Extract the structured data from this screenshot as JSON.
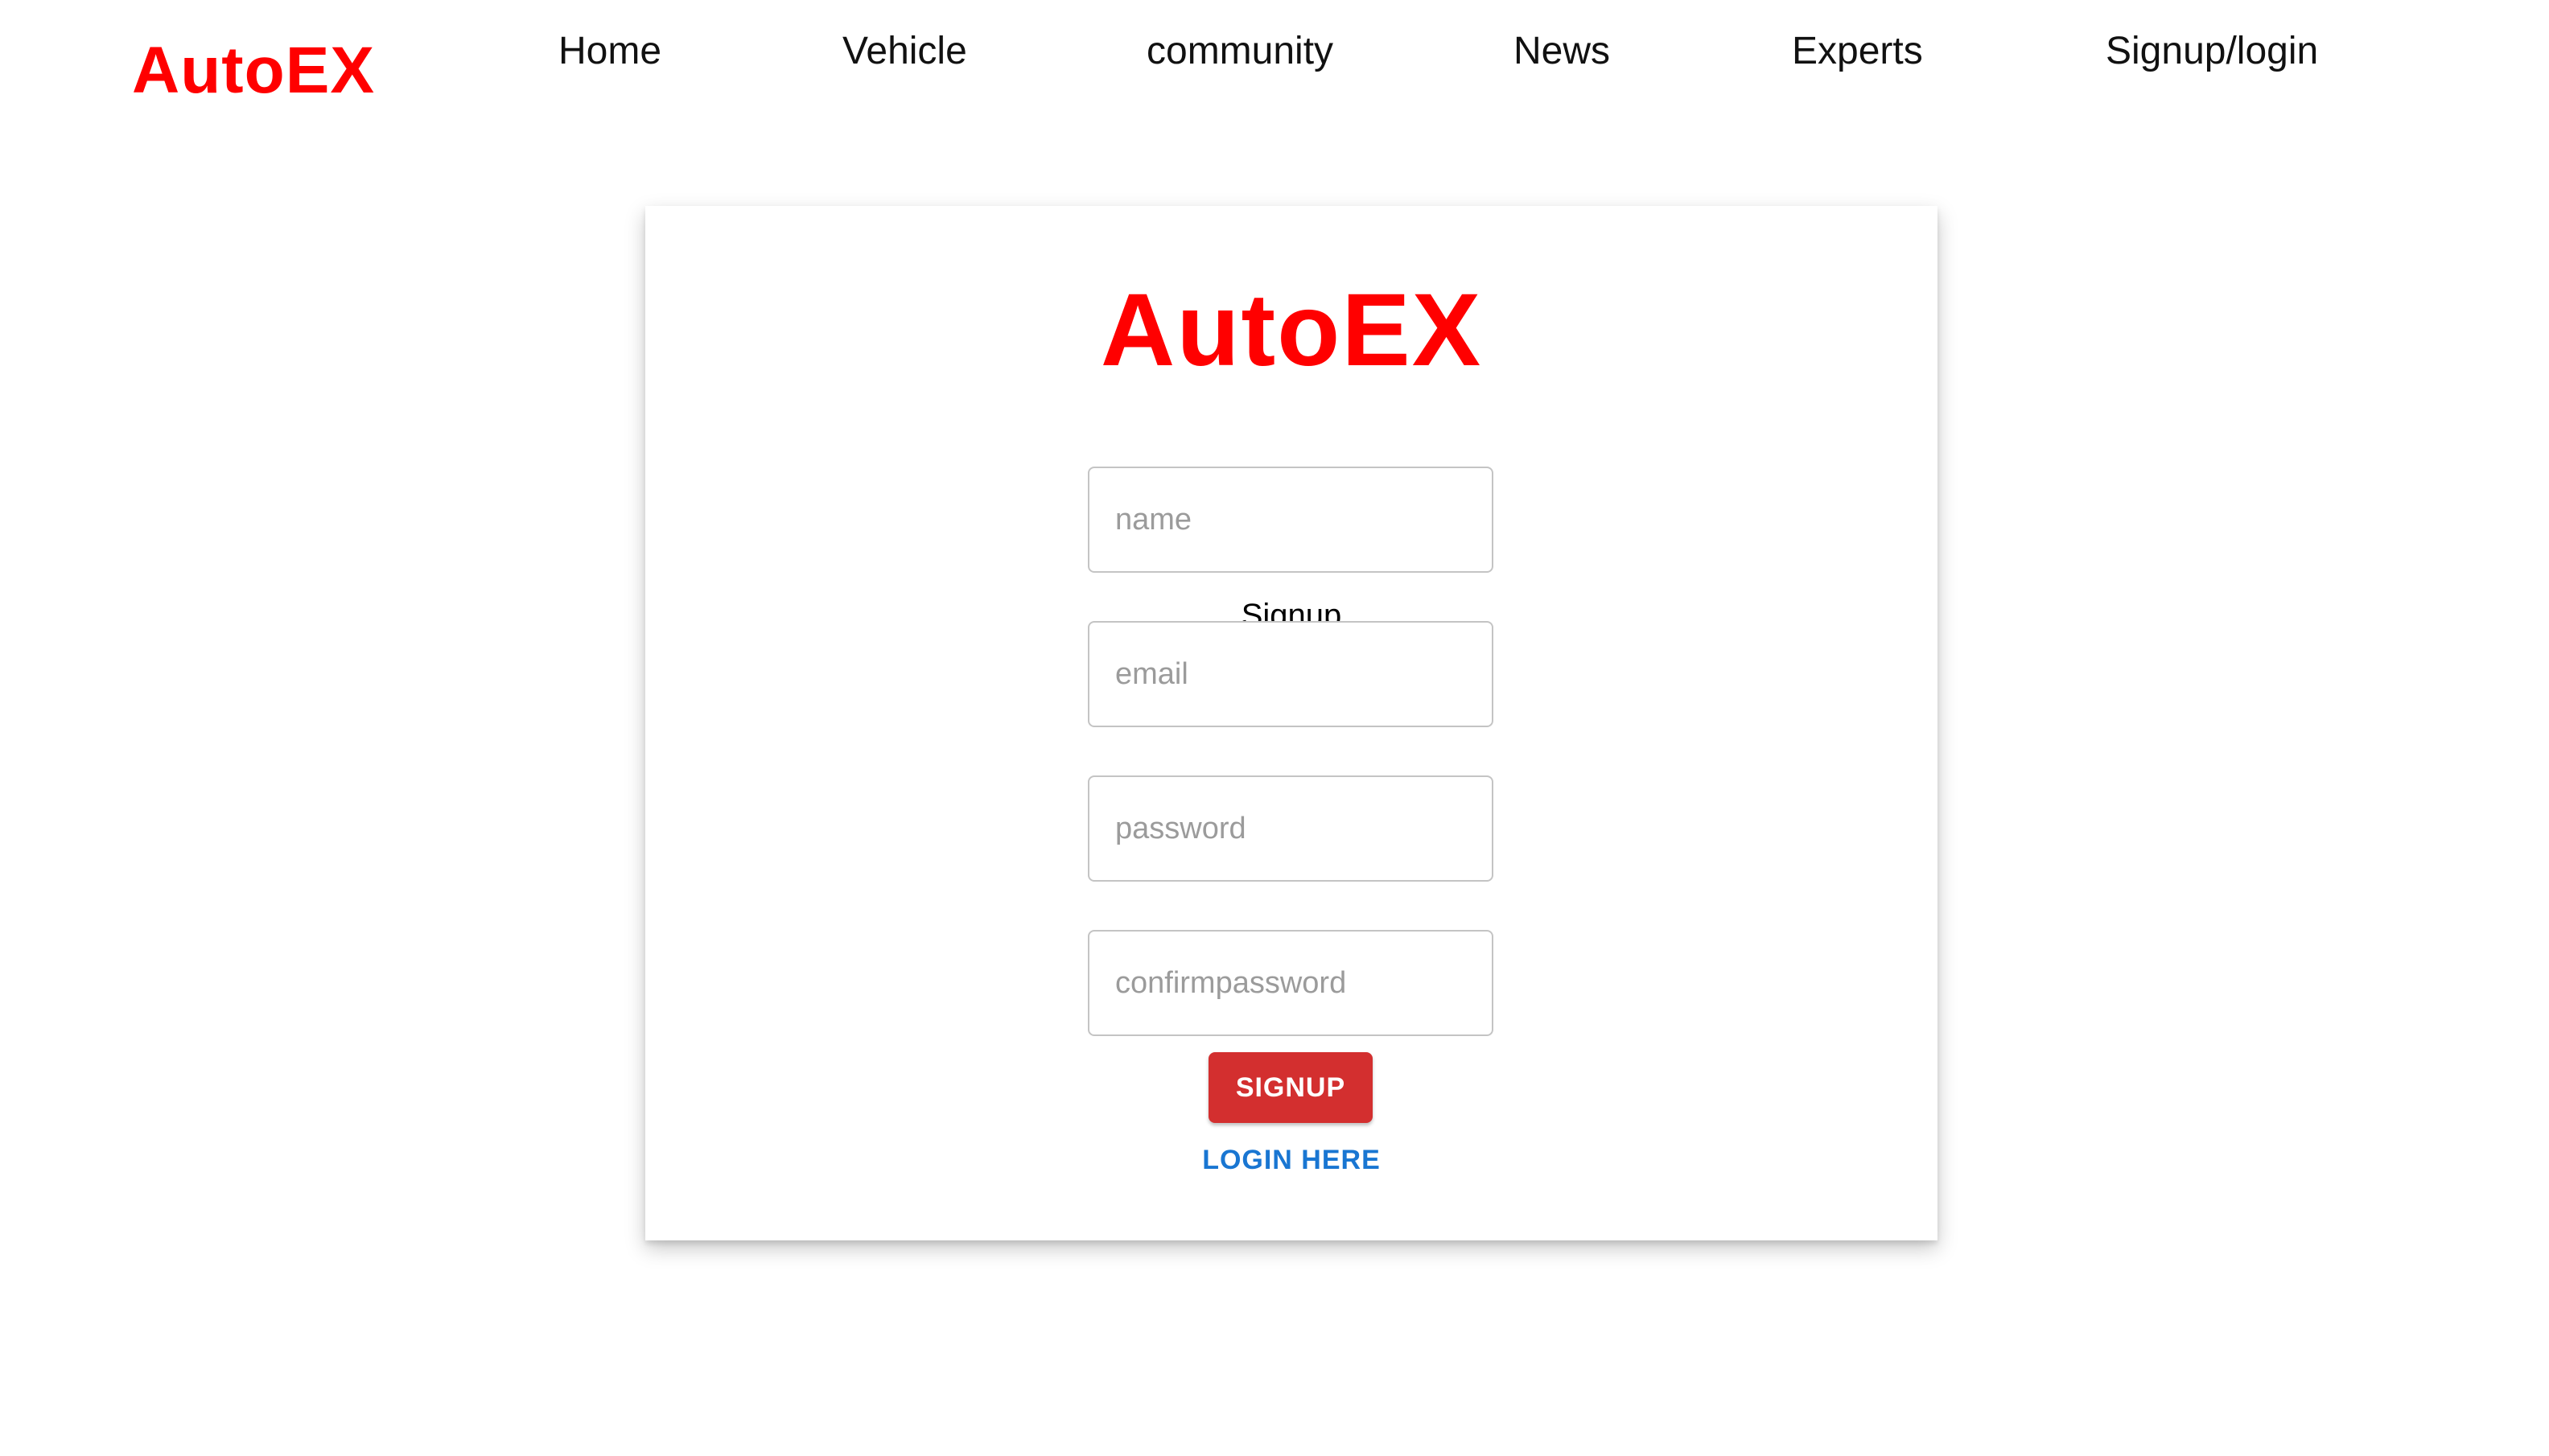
{
  "colors": {
    "brand": "#ff0000",
    "button_bg": "#d32f2f",
    "link": "#1976d2"
  },
  "navbar": {
    "brand": "AutoEX",
    "links": [
      "Home",
      "Vehicle",
      "community",
      "News",
      "Experts",
      "Signup/login"
    ]
  },
  "signup_card": {
    "brand": "AutoEX",
    "title": "Signup",
    "fields": {
      "name": {
        "value": "",
        "placeholder": "name"
      },
      "email": {
        "value": "",
        "placeholder": "email"
      },
      "password": {
        "value": "",
        "placeholder": "password"
      },
      "confirmpassword": {
        "value": "",
        "placeholder": "confirmpassword"
      }
    },
    "signup_button": "SIGNUP",
    "login_link": "LOGIN HERE"
  }
}
